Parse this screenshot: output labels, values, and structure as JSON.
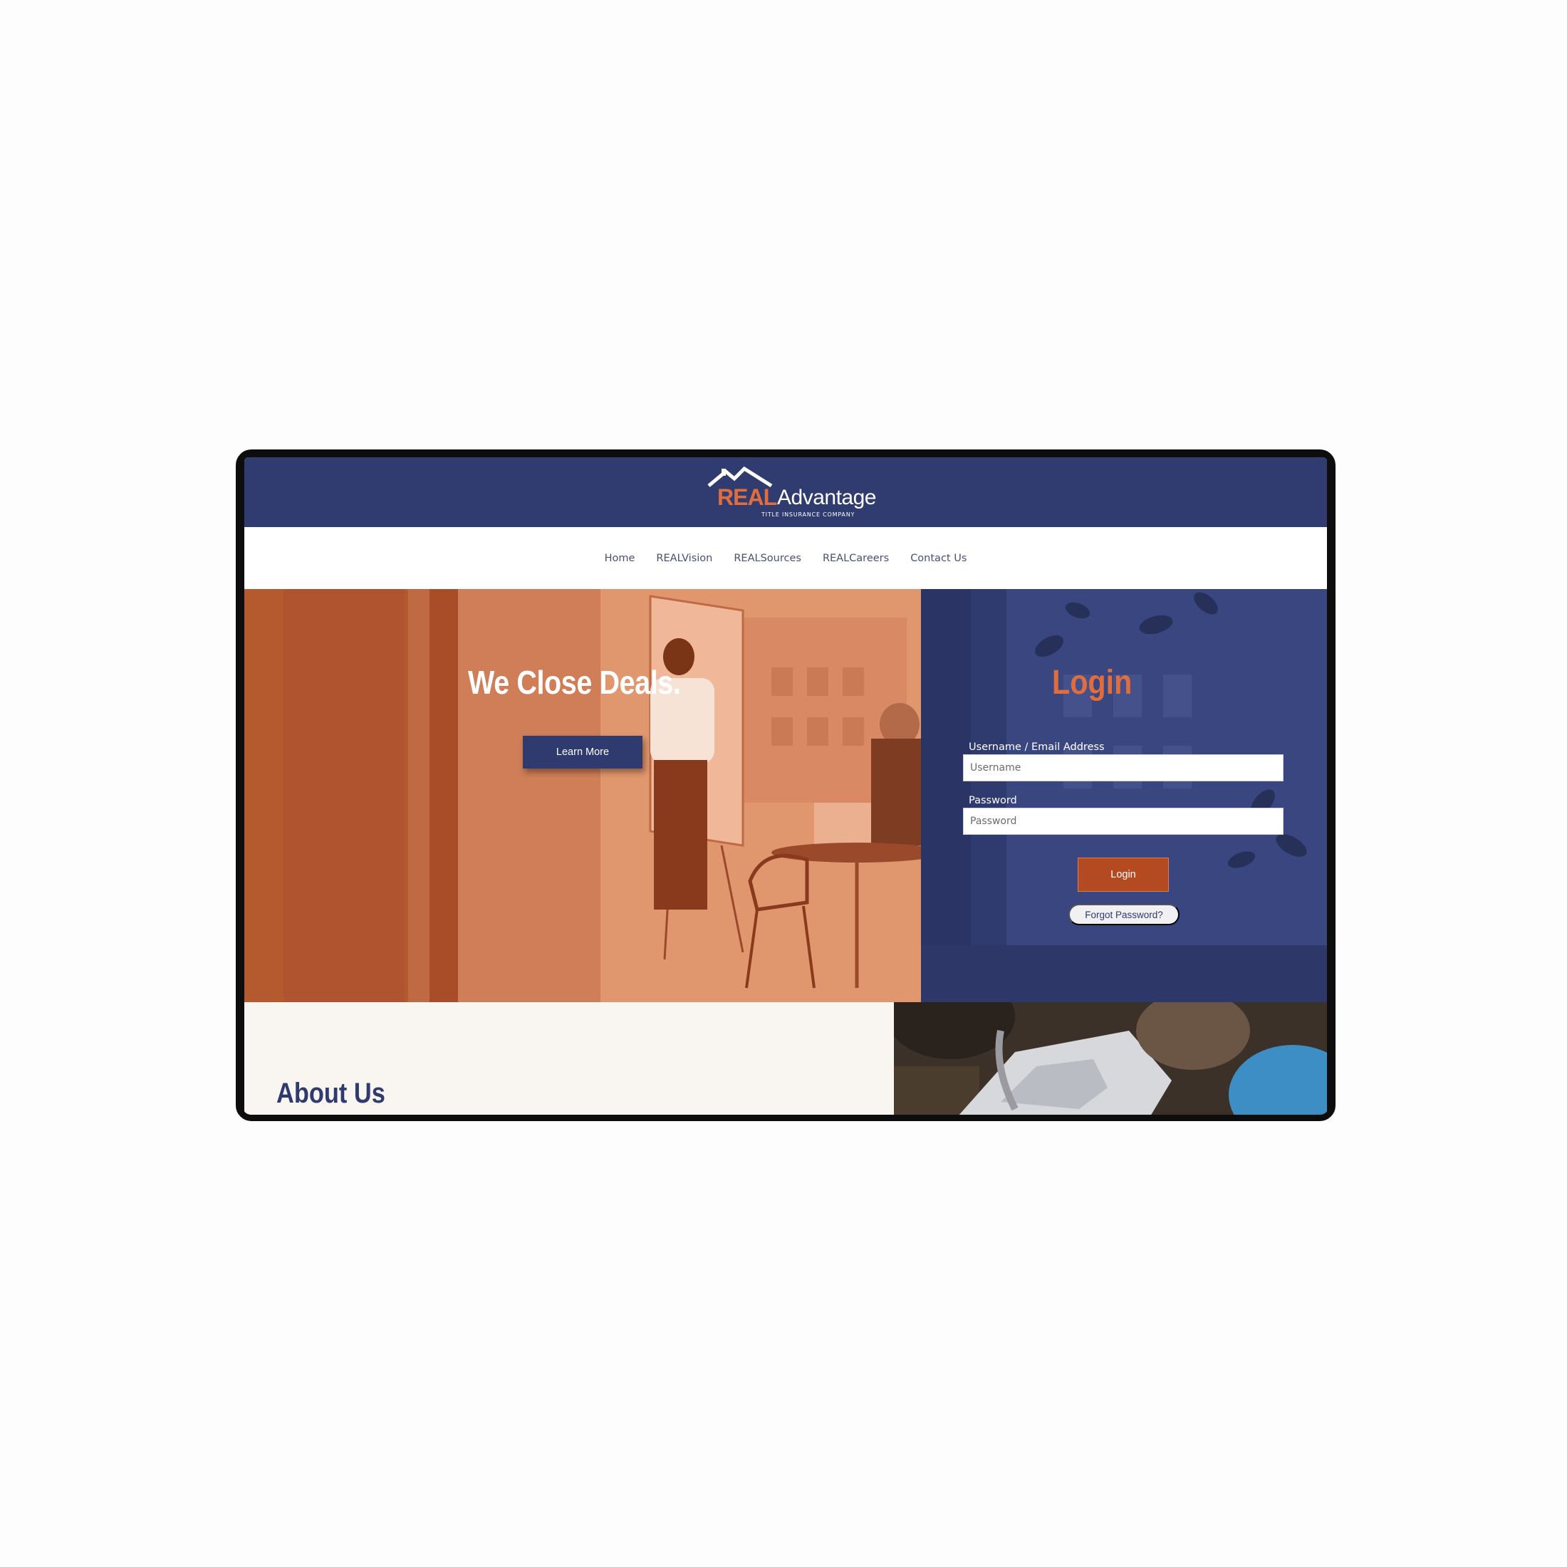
{
  "brand": {
    "name_part1": "REAL",
    "name_part2": "Advantage",
    "tagline": "TITLE INSURANCE COMPANY",
    "colors": {
      "navy": "#303c70",
      "orange": "#e06d3e",
      "rust": "#b34a22",
      "cream": "#f9f6f1"
    }
  },
  "nav": {
    "items": [
      {
        "label": "Home"
      },
      {
        "label": "REALVision"
      },
      {
        "label": "REALSources"
      },
      {
        "label": "REALCareers"
      },
      {
        "label": "Contact Us"
      }
    ]
  },
  "hero": {
    "heading": "We Close Deals.",
    "cta_label": "Learn More"
  },
  "login": {
    "title": "Login",
    "username_label": "Username / Email Address",
    "username_placeholder": "Username",
    "password_label": "Password",
    "password_placeholder": "Password",
    "submit_label": "Login",
    "forgot_label": "Forgot Password?"
  },
  "about": {
    "title": "About Us"
  }
}
